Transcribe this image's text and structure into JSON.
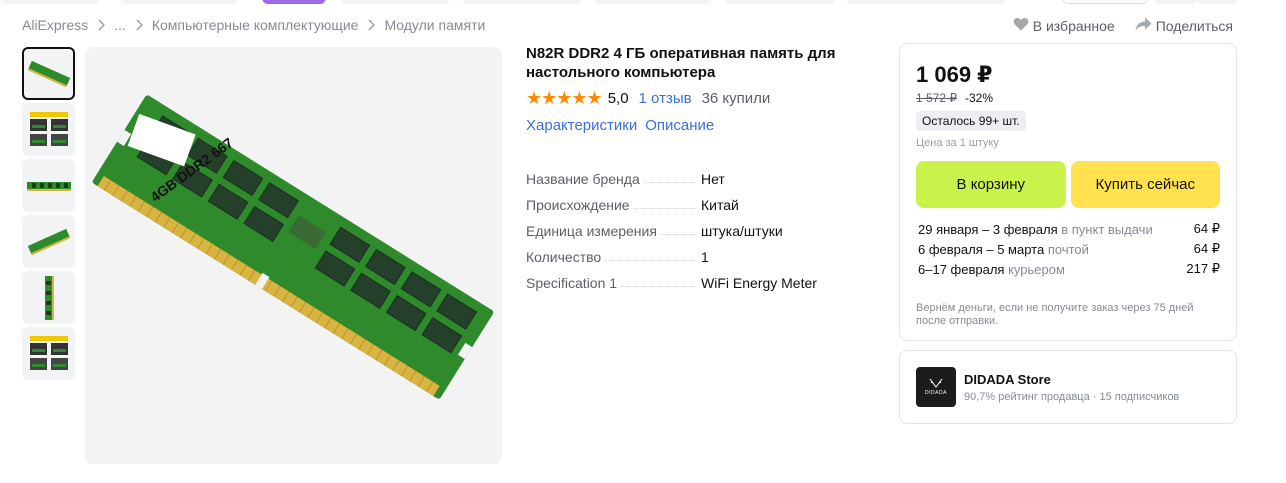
{
  "breadcrumb": {
    "items": [
      "AliExpress",
      "...",
      "Компьютерные комплектующие",
      "Модули памяти"
    ]
  },
  "actions": {
    "favorite": "В избранное",
    "share": "Поделиться"
  },
  "gallery": {
    "selected_index": 0,
    "main_image_label": "4GB DDR2 667"
  },
  "product": {
    "title": "N82R DDR2 4 ГБ оперативная память для настольного компьютера",
    "stars": "★★★★★",
    "rating": "5,0",
    "reviews": "1 отзыв",
    "bought": "36 купили",
    "tabs": [
      "Характеристики",
      "Описание"
    ],
    "specs": [
      {
        "name": "Название бренда",
        "value": "Нет"
      },
      {
        "name": "Происхождение",
        "value": "Китай"
      },
      {
        "name": "Единица измерения",
        "value": "штука/штуки"
      },
      {
        "name": "Количество",
        "value": "1"
      },
      {
        "name": "Specification 1",
        "value": "WiFi Energy Meter"
      }
    ]
  },
  "buybox": {
    "price": "1 069 ₽",
    "old_price": "1 572 ₽",
    "discount": "-32%",
    "stock": "Осталось 99+ шт.",
    "unit_note": "Цена за 1 штуку",
    "cart_button": "В корзину",
    "buy_button": "Купить сейчас",
    "delivery": [
      {
        "date": "29 января – 3 февраля",
        "mode": "в пункт выдачи",
        "price": "64 ₽"
      },
      {
        "date": "6 февраля – 5 марта",
        "mode": "почтой",
        "price": "64 ₽"
      },
      {
        "date": "6–17 февраля",
        "mode": "курьером",
        "price": "217 ₽"
      }
    ],
    "refund": "Вернём деньги, если не получите заказ через 75 дней после отправки."
  },
  "store": {
    "logo_text": "DIDADA",
    "name": "DIDADA Store",
    "rating": "90,7% рейтинг продавца",
    "subscribers": "15 подписчиков"
  },
  "colors": {
    "accent_link": "#3d6fdb",
    "cart_button": "#c9f24a",
    "buy_button": "#ffe24d",
    "star": "#ff8a00",
    "pcb_green": "#2f8a2c"
  }
}
